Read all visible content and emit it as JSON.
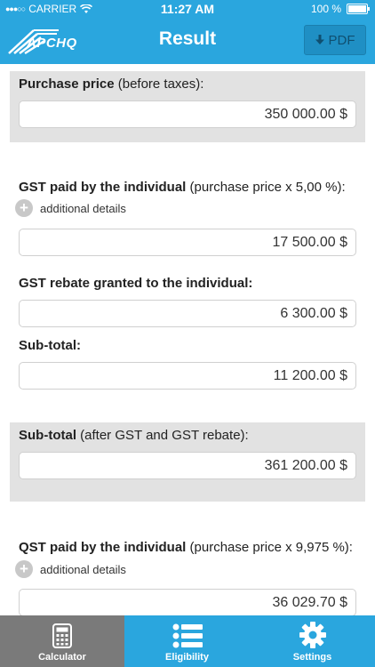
{
  "status_bar": {
    "carrier": "CARRIER",
    "time": "11:27 AM",
    "battery": "100 %"
  },
  "header": {
    "logo_text": "APCHQ",
    "title": "Result",
    "pdf_label": "PDF"
  },
  "sections": {
    "purchase_price": {
      "label_bold": "Purchase price",
      "label_rest": " (before taxes):",
      "value": "350 000.00 $"
    },
    "gst_paid": {
      "label_bold": "GST paid by the individual",
      "label_rest": " (purchase price x  5,00 %):",
      "details": "additional details",
      "value": "17 500.00 $"
    },
    "gst_rebate": {
      "label_bold": "GST rebate granted to the individual:",
      "value": "6 300.00 $"
    },
    "subtotal_1": {
      "label_bold": "Sub-total:",
      "value": "11 200.00 $"
    },
    "subtotal_2": {
      "label_bold": "Sub-total",
      "label_rest": " (after GST and GST rebate):",
      "value": "361 200.00 $"
    },
    "qst_paid": {
      "label_bold": "QST paid by the individual",
      "label_rest": " (purchase price x 9,975 %):",
      "details": "additional details",
      "value": "36 029.70 $"
    }
  },
  "tabs": [
    {
      "label": "Calculator",
      "icon": "calculator-icon",
      "active": true
    },
    {
      "label": "Eligibility",
      "icon": "list-icon",
      "active": false
    },
    {
      "label": "Settings",
      "icon": "gear-icon",
      "active": false
    }
  ],
  "colors": {
    "primary": "#2aa6de",
    "active_tab": "#7a7a7a",
    "section_gray": "#e2e2e2"
  }
}
